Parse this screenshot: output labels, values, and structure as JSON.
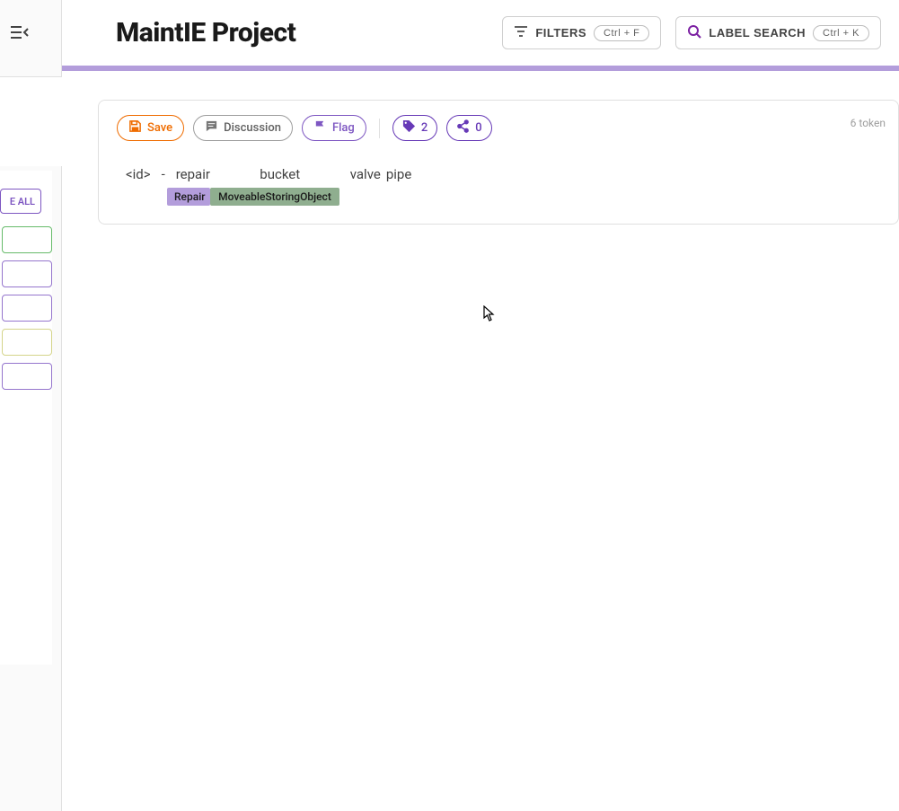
{
  "header": {
    "title": "MaintIE Project",
    "filters_label": "FILTERS",
    "filters_shortcut": "Ctrl + F",
    "label_search_label": "LABEL SEARCH",
    "label_search_shortcut": "Ctrl + K"
  },
  "sidebar": {
    "expand_all_label": "E ALL"
  },
  "toolbar": {
    "save_label": "Save",
    "discussion_label": "Discussion",
    "flag_label": "Flag",
    "tag_count": "2",
    "share_count": "0"
  },
  "meta": {
    "token_info": "6 token"
  },
  "tokens": {
    "t0": "<id>",
    "t1": "-",
    "t2": "repair",
    "t3": "bucket",
    "t4": "valve",
    "t5": "pipe"
  },
  "labels": {
    "repair": "Repair",
    "moveable": "MoveableStoringObject"
  }
}
